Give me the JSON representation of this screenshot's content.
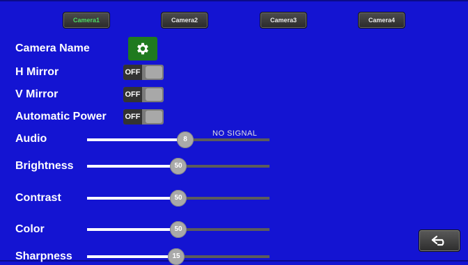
{
  "tabs": [
    {
      "label": "Camera1",
      "active": true
    },
    {
      "label": "Camera2",
      "active": false
    },
    {
      "label": "Camera3",
      "active": false
    },
    {
      "label": "Camera4",
      "active": false
    }
  ],
  "camera_name": {
    "label": "Camera Name",
    "icon": "gear-icon"
  },
  "toggles": {
    "h_mirror": {
      "label": "H Mirror",
      "state": "OFF"
    },
    "v_mirror": {
      "label": "V Mirror",
      "state": "OFF"
    },
    "automatic_power": {
      "label": "Automatic Power",
      "state": "OFF"
    }
  },
  "sliders": {
    "audio": {
      "label": "Audio",
      "value": "8",
      "level": 0.54
    },
    "brightness": {
      "label": "Brightness",
      "value": "50",
      "level": 0.5
    },
    "contrast": {
      "label": "Contrast",
      "value": "50",
      "level": 0.5
    },
    "color": {
      "label": "Color",
      "value": "50",
      "level": 0.5
    },
    "sharpness": {
      "label": "Sharpness",
      "value": "15",
      "level": 0.49
    }
  },
  "status_text": "NO SIGNAL",
  "back_button": {
    "icon": "back-arrow-icon"
  },
  "colors": {
    "background": "#1414d2",
    "active_tab_text": "#4cd964",
    "gear_button": "#1f7a1f"
  }
}
